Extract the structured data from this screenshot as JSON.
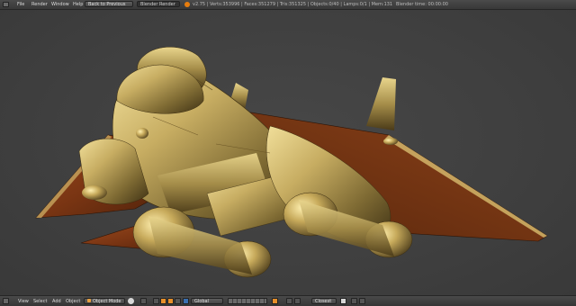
{
  "menu": {
    "items": [
      "File",
      "Render",
      "Window",
      "Help"
    ]
  },
  "header": {
    "back_button": "Back to Previous",
    "render_engine": "Blender Render"
  },
  "status": {
    "version_info": "v2.75 | Verts:353996 | Faces:351279 | Tris:351325 | Objects:0/40 | Lamps:0/1 | Mem:131.91M | Rndr:bo",
    "right_info": "Blender time: 00:00:00"
  },
  "footer": {
    "view": "View",
    "select": "Select",
    "add": "Add",
    "object": "Object",
    "mode": "Object Mode",
    "orientation": "Global",
    "snap": "Closest"
  },
  "colors": {
    "metal_light": "#e3cf86",
    "metal_mid": "#9a8445",
    "metal_dark": "#3d3014",
    "wing_rust": "#7a3513",
    "wing_dark": "#4a200a"
  }
}
